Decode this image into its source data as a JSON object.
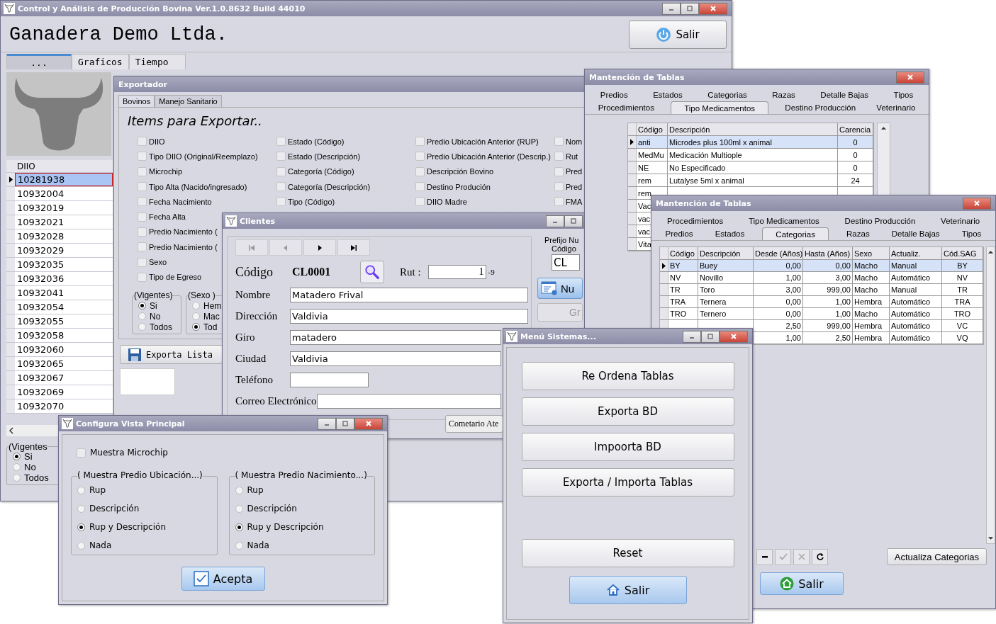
{
  "main": {
    "title": "Control y Análisis de Producción Bovina  Ver.1.0.8632 Build 44010",
    "company": "Ganadera Demo Ltda.",
    "exit_button": "Salir",
    "tabs": [
      {
        "label": "...",
        "selected": true
      },
      {
        "label": "Graficos",
        "selected": false
      },
      {
        "label": "Tiempo",
        "selected": false
      }
    ],
    "grid_header": "DIIO",
    "rows": [
      {
        "value": "10281938",
        "selected": true
      },
      {
        "value": "10932004",
        "selected": false
      },
      {
        "value": "10932019",
        "selected": false
      },
      {
        "value": "10932021",
        "selected": false
      },
      {
        "value": "10932028",
        "selected": false
      },
      {
        "value": "10932029",
        "selected": false
      },
      {
        "value": "10932035",
        "selected": false
      },
      {
        "value": "10932036",
        "selected": false
      },
      {
        "value": "10932041",
        "selected": false
      },
      {
        "value": "10932054",
        "selected": false
      },
      {
        "value": "10932055",
        "selected": false
      },
      {
        "value": "10932058",
        "selected": false
      },
      {
        "value": "10932060",
        "selected": false
      },
      {
        "value": "10932065",
        "selected": false
      },
      {
        "value": "10932067",
        "selected": false
      },
      {
        "value": "10932069",
        "selected": false
      },
      {
        "value": "10932070",
        "selected": false
      }
    ],
    "filter": {
      "title": "(Vigentes",
      "options": [
        {
          "label": "Si",
          "selected": true
        },
        {
          "label": "No",
          "selected": false
        },
        {
          "label": "Todos",
          "selected": false
        }
      ]
    }
  },
  "exporter": {
    "title": "Exportador",
    "tabs": [
      {
        "label": "Bovinos",
        "selected": true
      },
      {
        "label": "Manejo Sanitario",
        "selected": false
      }
    ],
    "heading": "Items para Exportar..",
    "columns": [
      [
        {
          "label": "DIIO",
          "checked": false
        },
        {
          "label": "Tipo DIIO (Original/Reemplazo)",
          "checked": false
        },
        {
          "label": "Microchip",
          "checked": false
        },
        {
          "label": "Tipo Alta (Nacido/ingresado)",
          "checked": false
        },
        {
          "label": "Fecha Nacimiento",
          "checked": false
        },
        {
          "label": "Fecha Alta",
          "checked": false
        },
        {
          "label": "Predio Nacimiento (",
          "checked": false
        },
        {
          "label": "Predio Nacimiento (",
          "checked": false
        },
        {
          "label": "Sexo",
          "checked": false
        },
        {
          "label": "Tipo de Egreso",
          "checked": false
        }
      ],
      [
        {
          "label": "Estado (Código)",
          "checked": false
        },
        {
          "label": "Estado (Descripción)",
          "checked": false
        },
        {
          "label": "Categoría (Código)",
          "checked": false
        },
        {
          "label": "Categoría (Descripción)",
          "checked": false
        },
        {
          "label": "Tipo (Código)",
          "checked": false
        }
      ],
      [
        {
          "label": "Predio Ubicación Anterior (RUP)",
          "checked": false
        },
        {
          "label": "Predio Ubicación Anterior (Descrip.)",
          "checked": false
        },
        {
          "label": "Descripción Bovino",
          "checked": false
        },
        {
          "label": "Destino Produción",
          "checked": false
        },
        {
          "label": "DIIO Madre",
          "checked": false
        }
      ],
      [
        {
          "label": "Nom",
          "checked": false
        },
        {
          "label": "Rut",
          "checked": false
        },
        {
          "label": "Pred",
          "checked": false
        },
        {
          "label": "Pred",
          "checked": false
        },
        {
          "label": "FMA",
          "checked": false
        }
      ]
    ],
    "groups": [
      {
        "title": "(Vigentes)",
        "options": [
          {
            "label": "Si",
            "selected": true
          },
          {
            "label": "No",
            "selected": false
          },
          {
            "label": "Todos",
            "selected": false
          }
        ]
      },
      {
        "title": "(Sexo )",
        "options": [
          {
            "label": "Hem",
            "selected": false
          },
          {
            "label": "Mac",
            "selected": false
          },
          {
            "label": "Tod",
            "selected": true
          }
        ]
      }
    ],
    "export_button": "Exporta Lista"
  },
  "clients": {
    "title": "Clientes",
    "code_label": "Código",
    "code": "CL0001",
    "rut_label": "Rut :",
    "rut": "1",
    "rut_dv": "-9",
    "fields": [
      {
        "label": "Nombre",
        "value": "Matadero Frival",
        "kind": "long"
      },
      {
        "label": "Dirección",
        "value": "Valdivia",
        "kind": "long"
      },
      {
        "label": "Giro",
        "value": "matadero",
        "kind": "medium"
      },
      {
        "label": "Ciudad",
        "value": "Valdivia",
        "kind": "medium"
      },
      {
        "label": "Teléfono",
        "kind": "short"
      },
      {
        "label": "Correo Electrónico",
        "kind": "medium"
      }
    ],
    "prefix_label": [
      "Prefijo Nu",
      "Código"
    ],
    "prefix": "CL",
    "new_button": "Nu",
    "save_button": {
      "label": "Gr",
      "disabled": true
    },
    "comment_button": "Cometario Ate"
  },
  "medicines": {
    "title": "Mantención de Tablas",
    "tab_rows": [
      [
        {
          "label": "Predios",
          "selected": false
        },
        {
          "label": "Estados",
          "selected": false
        },
        {
          "label": "Categorias",
          "selected": false
        },
        {
          "label": "Razas",
          "selected": false
        },
        {
          "label": "Detalle Bajas",
          "selected": false
        },
        {
          "label": "Tipos",
          "selected": false
        }
      ],
      [
        {
          "label": "Procedimientos",
          "selected": false
        },
        {
          "label": "Tipo Medicamentos",
          "selected": true
        },
        {
          "label": "Destino Producción",
          "selected": false
        },
        {
          "label": "Veterinario",
          "selected": false
        }
      ]
    ],
    "columns": [
      {
        "label": "Código",
        "kind": "text"
      },
      {
        "label": "Descripción",
        "kind": "text"
      },
      {
        "label": "Carencia",
        "kind": "center"
      }
    ],
    "rows": [
      {
        "selected": true,
        "cells": [
          "anti",
          "Microdes plus 100ml x animal",
          "0"
        ]
      },
      {
        "selected": false,
        "cells": [
          "MedMu",
          "Medicación Multiople",
          "0"
        ]
      },
      {
        "selected": false,
        "cells": [
          "NE",
          "No Especificado",
          "0"
        ]
      },
      {
        "selected": false,
        "cells": [
          "rem",
          "Lutalyse 5ml x animal",
          "24"
        ]
      },
      {
        "selected": false,
        "cells": [
          "rem"
        ]
      },
      {
        "selected": false,
        "cells": [
          "Vac"
        ]
      },
      {
        "selected": false,
        "cells": [
          "vac"
        ]
      },
      {
        "selected": false,
        "cells": [
          "vac"
        ]
      },
      {
        "selected": false,
        "cells": [
          "Vita"
        ]
      }
    ]
  },
  "categories": {
    "title": "Mantención de Tablas",
    "tab_rows": [
      [
        {
          "label": "Procedimientos",
          "selected": false
        },
        {
          "label": "Tipo Medicamentos",
          "selected": false
        },
        {
          "label": "Destino Producción",
          "selected": false
        },
        {
          "label": "Veterinario",
          "selected": false
        }
      ],
      [
        {
          "label": "Predios",
          "selected": false
        },
        {
          "label": "Estados",
          "selected": false
        },
        {
          "label": "Categorias",
          "selected": true
        },
        {
          "label": "Razas",
          "selected": false
        },
        {
          "label": "Detalle Bajas",
          "selected": false
        },
        {
          "label": "Tipos",
          "selected": false
        }
      ]
    ],
    "columns": [
      {
        "label": "Código",
        "kind": "text"
      },
      {
        "label": "Descripción",
        "kind": "text"
      },
      {
        "label": "Desde (Años)",
        "kind": "number"
      },
      {
        "label": "Hasta (Años)",
        "kind": "number"
      },
      {
        "label": "Sexo",
        "kind": "text"
      },
      {
        "label": "Actualiz.",
        "kind": "text"
      },
      {
        "label": "Cód.SAG",
        "kind": "center"
      }
    ],
    "rows": [
      {
        "selected": true,
        "cells": [
          "BY",
          "Buey",
          "0,00",
          "0,00",
          "Macho",
          "Manual",
          "BY"
        ]
      },
      {
        "selected": false,
        "cells": [
          "NV",
          "Novillo",
          "1,00",
          "3,00",
          "Macho",
          "Automático",
          "NV"
        ]
      },
      {
        "selected": false,
        "cells": [
          "TR",
          "Toro",
          "3,00",
          "999,00",
          "Macho",
          "Manual",
          "TR"
        ]
      },
      {
        "selected": false,
        "cells": [
          "TRA",
          "Ternera",
          "0,00",
          "1,00",
          "Hembra",
          "Automático",
          "TRA"
        ]
      },
      {
        "selected": false,
        "cells": [
          "TRO",
          "Ternero",
          "0,00",
          "1,00",
          "Macho",
          "Automático",
          "TRO"
        ]
      },
      {
        "selected": false,
        "cells": [
          null,
          null,
          "2,50",
          "999,00",
          "Hembra",
          "Automático",
          "VC"
        ]
      },
      {
        "selected": false,
        "cells": [
          null,
          null,
          "1,00",
          "2,50",
          "Hembra",
          "Automático",
          "VQ"
        ]
      }
    ],
    "toolbar": [
      {
        "kind": "delete",
        "disabled": false
      },
      {
        "kind": "confirm",
        "disabled": true
      },
      {
        "kind": "cancel",
        "disabled": true
      },
      {
        "kind": "refresh",
        "disabled": false
      }
    ],
    "update_button": "Actualiza Categorias",
    "exit_button": "Salir"
  },
  "system_menu": {
    "title": "Menú Sistemas...",
    "buttons": [
      "Re Ordena Tablas",
      "Exporta BD",
      "Impoorta BD",
      "Exporta / Importa Tablas"
    ],
    "reset_button": "Reset",
    "exit_button": "Salir"
  },
  "view_config": {
    "title": "Configura Vista Principal",
    "microchip": {
      "label": "Muestra Microchip",
      "checked": false
    },
    "groups": [
      {
        "title": "( Muestra Predio Ubicación...)",
        "options": [
          {
            "label": "Rup",
            "selected": false
          },
          {
            "label": "Descripción",
            "selected": false
          },
          {
            "label": "Rup y Descripción",
            "selected": true
          },
          {
            "label": "Nada",
            "selected": false
          }
        ]
      },
      {
        "title": "( Muestra Predio Nacimiento...)",
        "options": [
          {
            "label": "Rup",
            "selected": false
          },
          {
            "label": "Descripción",
            "selected": false
          },
          {
            "label": "Rup y Descripción",
            "selected": true
          },
          {
            "label": "Nada",
            "selected": false
          }
        ]
      }
    ],
    "accept_button": "Acepta"
  }
}
